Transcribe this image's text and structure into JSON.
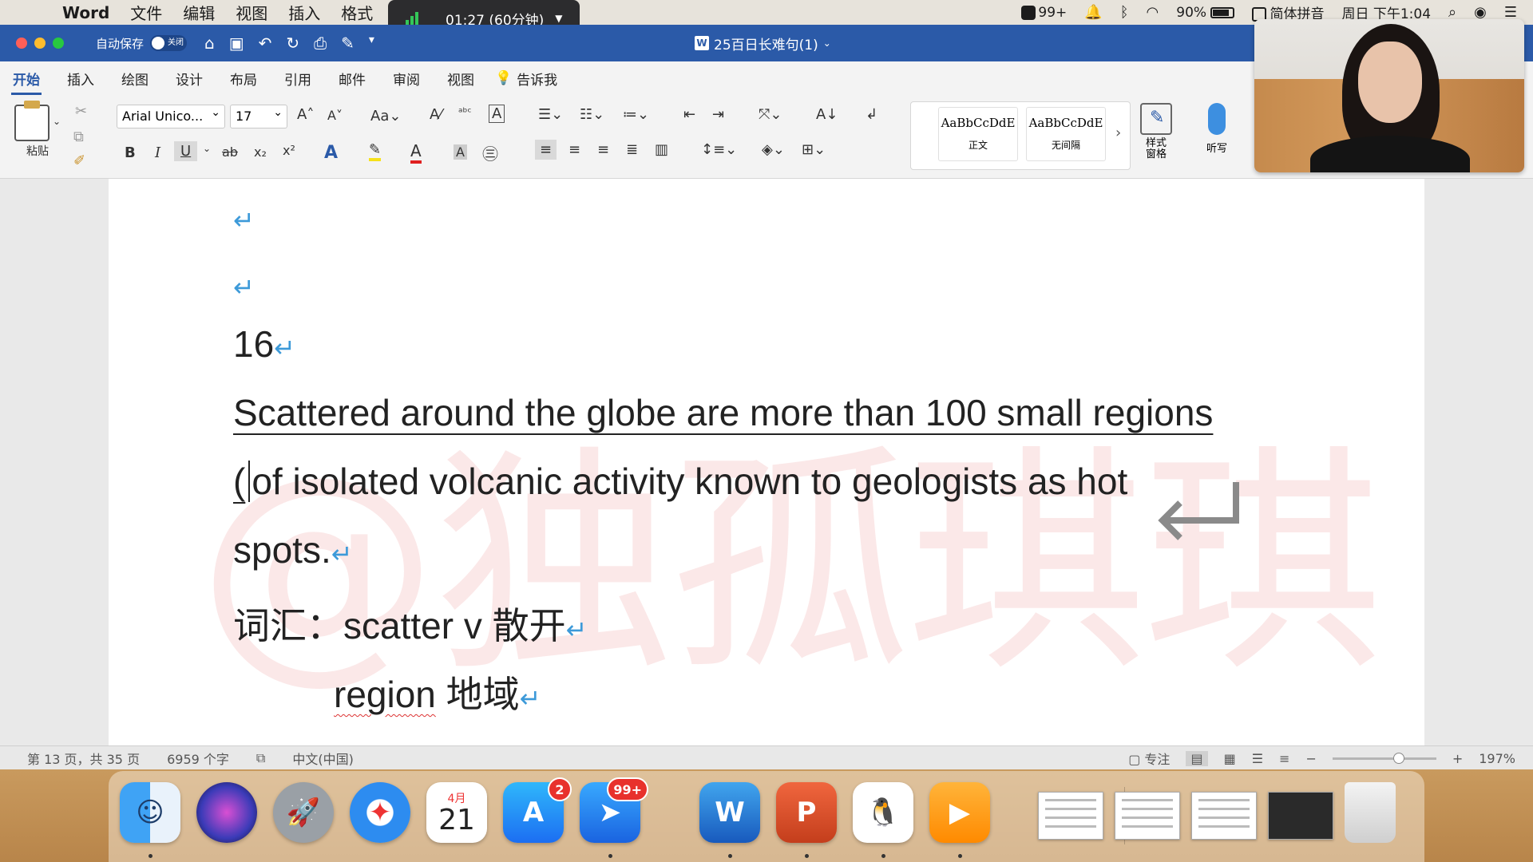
{
  "menubar": {
    "app": "Word",
    "items": [
      "文件",
      "编辑",
      "视图",
      "插入",
      "格式"
    ],
    "recording": {
      "time": "01:27 (60分钟)"
    },
    "right": {
      "notifications": "99+",
      "battery": "90%",
      "input_method": "简体拼音",
      "clock": "周日 下午1:04"
    }
  },
  "titlebar": {
    "autosave_label": "自动保存",
    "autosave_state": "关闭",
    "doc_title": "25百日长难句(1)"
  },
  "ribbon_tabs": [
    "开始",
    "插入",
    "绘图",
    "设计",
    "布局",
    "引用",
    "邮件",
    "审阅",
    "视图"
  ],
  "tell_me": "告诉我",
  "ribbon": {
    "paste": "粘贴",
    "font_name": "Arial Unico...",
    "font_size": "17",
    "styles": [
      {
        "sample": "AaBbCcDdE",
        "name": "正文"
      },
      {
        "sample": "AaBbCcDdE",
        "name": "无间隔"
      }
    ],
    "styles_pane": "样式\n窗格",
    "dictate": "听写"
  },
  "document": {
    "number": "16",
    "sentence_l1": "Scattered around the globe are more than 100 small regions",
    "sentence_l2_open": "(",
    "sentence_l2": "of isolated volcanic activity known to geologists as hot",
    "sentence_l3": "spots.",
    "vocab_label": "词汇：",
    "vocab1_word": "scatter v",
    "vocab1_meaning": "散开",
    "vocab2_word": "region",
    "vocab2_meaning": "地域",
    "watermark": "@独孤琪琪"
  },
  "statusbar": {
    "page": "第 13 页，共 35 页",
    "words": "6959 个字",
    "language": "中文(中国)",
    "focus": "专注",
    "zoom": "197%"
  },
  "dock": {
    "calendar_month": "4月",
    "calendar_day": "21",
    "appstore_badge": "2",
    "feishu_badge": "99+"
  },
  "colors": {
    "word_blue": "#2b5aa8",
    "paragraph_mark": "#3d9ad9",
    "watermark": "#e67878"
  }
}
